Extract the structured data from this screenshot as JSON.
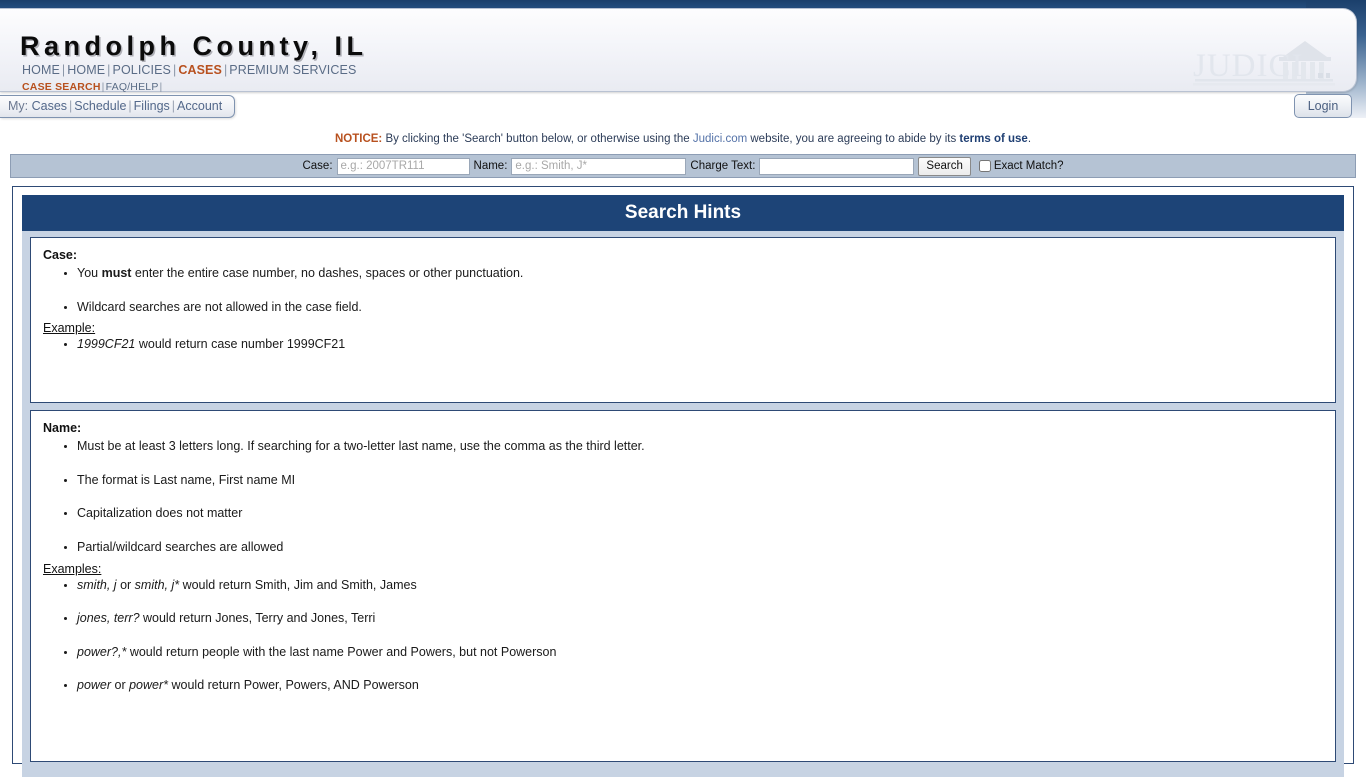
{
  "header": {
    "site_title": "Randolph County, IL",
    "logo_text": "JUDICI",
    "primary_nav": [
      {
        "label": "HOME",
        "active": false
      },
      {
        "label": "HOME",
        "active": false
      },
      {
        "label": "POLICIES",
        "active": false
      },
      {
        "label": "CASES",
        "active": true
      },
      {
        "label": "PREMIUM SERVICES",
        "active": false
      }
    ],
    "secondary_nav": [
      {
        "label": "CASE SEARCH",
        "active": true
      },
      {
        "label": "FAQ/HELP",
        "active": false
      }
    ]
  },
  "mytabs": {
    "prefix": "My:",
    "items": [
      "Cases",
      "Schedule",
      "Filings",
      "Account"
    ]
  },
  "login": {
    "label": "Login"
  },
  "notice": {
    "word": "NOTICE:",
    "text_before_link": " By clicking the 'Search' button below, or otherwise using the ",
    "link": "Judici.com",
    "text_mid": " website, you are agreeing to abide by its ",
    "terms_link": "terms of use",
    "text_after": "."
  },
  "search": {
    "case_label": "Case:",
    "case_placeholder": "e.g.: 2007TR111",
    "case_value": "",
    "name_label": "Name:",
    "name_placeholder": "e.g.: Smith, J*",
    "name_value": "",
    "charge_label": "Charge Text:",
    "charge_placeholder": "",
    "charge_value": "",
    "search_button": "Search",
    "exact_match_label": "Exact Match?",
    "exact_match_checked": false
  },
  "hints": {
    "title": "Search Hints",
    "case": {
      "heading": "Case:",
      "bullets": [
        {
          "parts": [
            {
              "t": "You ",
              "s": "n"
            },
            {
              "t": "must",
              "s": "b"
            },
            {
              "t": " enter the entire case number, no dashes, spaces or other punctuation.",
              "s": "n"
            }
          ]
        },
        {
          "parts": [
            {
              "t": "Wildcard searches are not allowed in the case field.",
              "s": "n"
            }
          ]
        }
      ],
      "example_heading": "Example:",
      "examples": [
        {
          "parts": [
            {
              "t": "1999CF21",
              "s": "i"
            },
            {
              "t": " would return case number 1999CF21",
              "s": "n"
            }
          ]
        }
      ]
    },
    "name": {
      "heading": "Name:",
      "bullets": [
        {
          "parts": [
            {
              "t": "Must be at least 3 letters long. If searching for a two-letter last name, use the comma as the third letter.",
              "s": "n"
            }
          ]
        },
        {
          "parts": [
            {
              "t": "The format is Last name, First name MI",
              "s": "n"
            }
          ]
        },
        {
          "parts": [
            {
              "t": "Capitalization does not matter",
              "s": "n"
            }
          ]
        },
        {
          "parts": [
            {
              "t": "Partial/wildcard searches are allowed",
              "s": "n"
            }
          ]
        }
      ],
      "example_heading": "Examples:",
      "examples": [
        {
          "parts": [
            {
              "t": "smith, j",
              "s": "i"
            },
            {
              "t": " or ",
              "s": "n"
            },
            {
              "t": "smith, j*",
              "s": "i"
            },
            {
              "t": " would return Smith, Jim and Smith, James",
              "s": "n"
            }
          ]
        },
        {
          "parts": [
            {
              "t": "jones, terr?",
              "s": "i"
            },
            {
              "t": " would return Jones, Terry and Jones, Terri",
              "s": "n"
            }
          ]
        },
        {
          "parts": [
            {
              "t": "power?,*",
              "s": "i"
            },
            {
              "t": " would return people with the last name Power and Powers, but not Powerson",
              "s": "n"
            }
          ]
        },
        {
          "parts": [
            {
              "t": "power",
              "s": "i"
            },
            {
              "t": " or ",
              "s": "n"
            },
            {
              "t": "power*",
              "s": "i"
            },
            {
              "t": " would return Power, Powers, AND Powerson",
              "s": "n"
            }
          ]
        }
      ]
    }
  },
  "colors": {
    "navy": "#1d4477",
    "accent_orange": "#b8511f",
    "panel_blue": "#c7d3e3",
    "searchbar_blue": "#b5c3d4",
    "link_blue": "#5472a8"
  }
}
